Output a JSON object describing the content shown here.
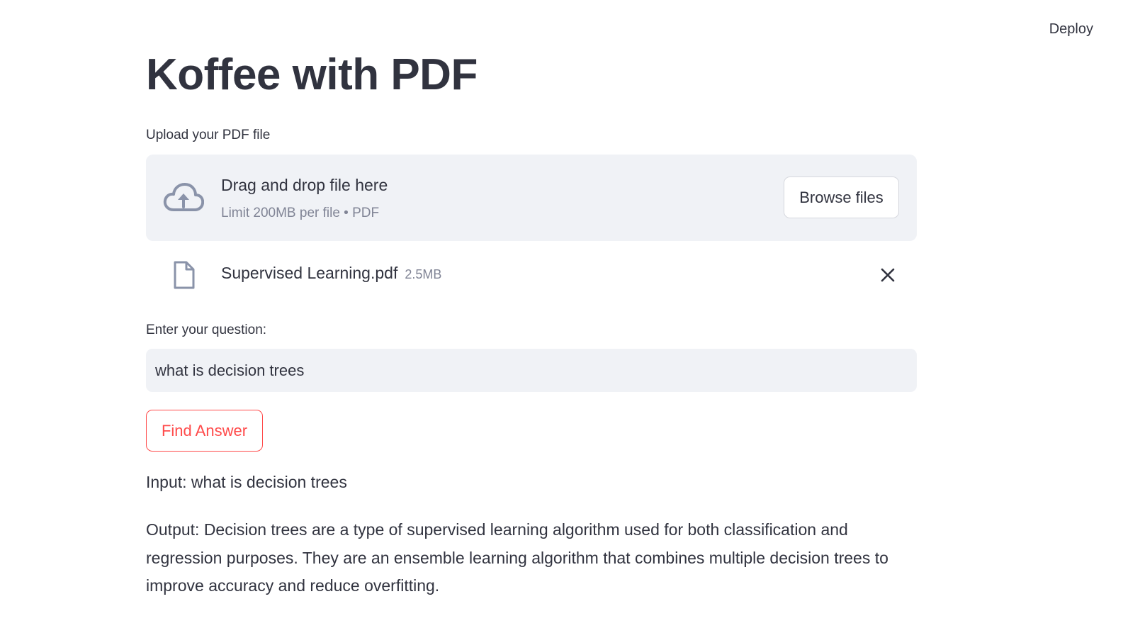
{
  "header": {
    "deploy_label": "Deploy"
  },
  "page": {
    "title": "Koffee with PDF"
  },
  "uploader": {
    "label": "Upload your PDF file",
    "drop_title": "Drag and drop file here",
    "drop_subtitle": "Limit 200MB per file • PDF",
    "browse_label": "Browse files",
    "icon": "cloud-upload-icon",
    "file": {
      "name": "Supervised Learning.pdf",
      "size": "2.5MB",
      "icon": "file-icon",
      "remove_icon": "close-icon"
    }
  },
  "question": {
    "label": "Enter your question:",
    "value": "what is decision trees"
  },
  "action": {
    "find_label": "Find Answer"
  },
  "result": {
    "input_text": "Input: what is decision trees",
    "output_text": "Output: Decision trees are a type of supervised learning algorithm used for both classification and regression purposes. They are an ensemble learning algorithm that combines multiple decision trees to improve accuracy and reduce overfitting."
  },
  "colors": {
    "text": "#31333f",
    "muted": "#808495",
    "surface": "#f0f2f6",
    "accent": "#ff4b4b"
  }
}
